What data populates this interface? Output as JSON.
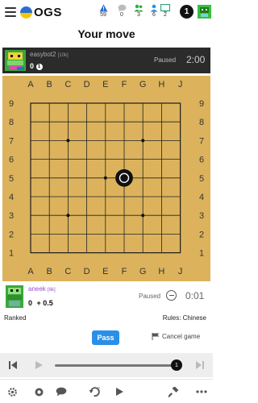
{
  "nav": {
    "logo_text": "OGS",
    "stats": [
      {
        "name": "warnings",
        "count": "59",
        "color": "#2a6ed3"
      },
      {
        "name": "chat",
        "count": "0",
        "color": "#999999"
      },
      {
        "name": "friends",
        "count": "3",
        "color": "#2faa3d"
      },
      {
        "name": "followers",
        "count": "6",
        "color": "#2a8fe8"
      },
      {
        "name": "games",
        "count": "2",
        "color": "#2aa07a"
      }
    ],
    "notification_count": "1"
  },
  "status": {
    "title": "Your move"
  },
  "players": {
    "top": {
      "name": "easybot2",
      "rank": "[10k]",
      "score": "0",
      "paused_label": "Paused",
      "clock": "2:00"
    },
    "bottom": {
      "name": "aneek",
      "rank": "[6k]",
      "score": "0",
      "komi": "+ 0.5",
      "paused_label": "Paused",
      "clock": "0:01"
    }
  },
  "board": {
    "size": 9,
    "columns": [
      "A",
      "B",
      "C",
      "D",
      "E",
      "F",
      "G",
      "H",
      "J"
    ],
    "rows": [
      "9",
      "8",
      "7",
      "6",
      "5",
      "4",
      "3",
      "2",
      "1"
    ],
    "stars": [
      [
        "C",
        "7"
      ],
      [
        "G",
        "7"
      ],
      [
        "E",
        "5"
      ],
      [
        "C",
        "3"
      ],
      [
        "G",
        "3"
      ]
    ],
    "stones": [
      {
        "col": "F",
        "row": "5",
        "color": "black",
        "last_move": true
      }
    ],
    "color": "#dcb35c"
  },
  "game_info": {
    "ranked_label": "Ranked",
    "rules_label": "Rules: Chinese",
    "pass_label": "Pass",
    "cancel_label": "Cancel game"
  },
  "controls": {
    "move_number": "1"
  },
  "toolbar": {
    "items": [
      "settings-icon",
      "score-icon",
      "chat-icon",
      "undo-request-icon",
      "play-icon",
      "hammer-icon",
      "more-icon"
    ]
  }
}
